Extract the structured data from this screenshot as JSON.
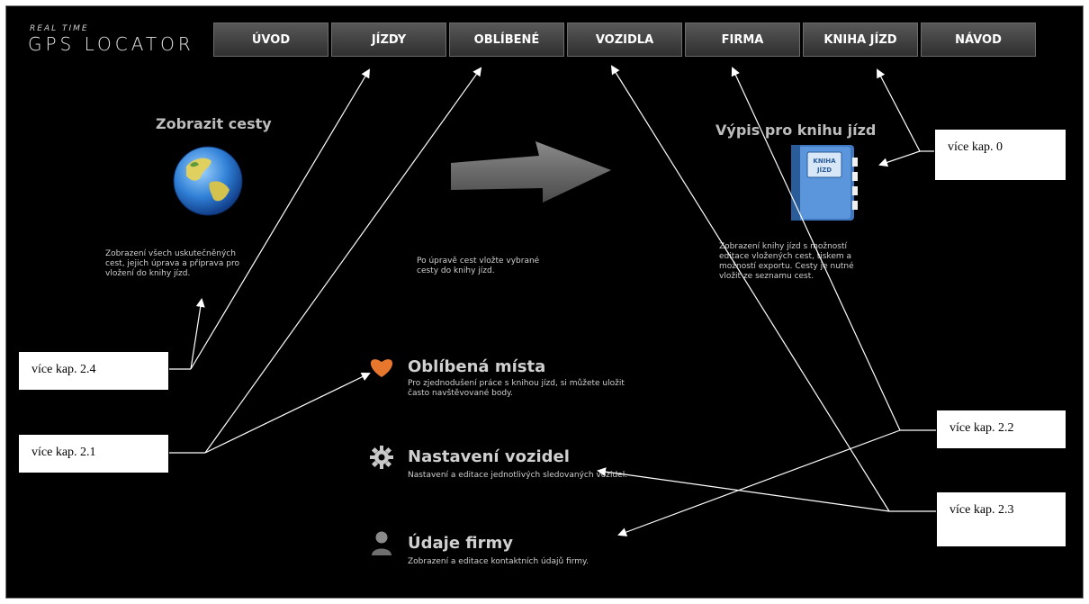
{
  "logo": {
    "top": "REAL TIME",
    "main": "GPS LOCATOR"
  },
  "nav": [
    "ÚVOD",
    "JÍZDY",
    "OBLÍBENÉ",
    "VOZIDLA",
    "FIRMA",
    "KNIHA JÍZD",
    "NÁVOD"
  ],
  "features": {
    "show_routes": {
      "title": "Zobrazit cesty",
      "desc1": "Zobrazení všech uskutečněných",
      "desc2": "cest, jejich úprava a příprava pro",
      "desc3": "vložení do knihy jízd."
    },
    "arrow_hint": {
      "desc1": "Po úpravě cest vložte vybrané",
      "desc2": "cesty do knihy jízd."
    },
    "logbook_export": {
      "title": "Výpis pro knihu jízd",
      "book_line1": "KNIHA",
      "book_line2": "JÍZD",
      "desc1": "Zobrazení knihy jízd s možností",
      "desc2": "editace vložených cest, tiskem a",
      "desc3": "možností exportu. Cesty je nutné",
      "desc4": "vložit ze seznamu cest."
    }
  },
  "items": {
    "favorites": {
      "title": "Oblíbená místa",
      "sub1": "Pro zjednodušení práce s knihou jízd, si můžete uložit",
      "sub2": "často navštěvované body."
    },
    "vehicles": {
      "title": "Nastavení vozidel",
      "sub1": "Nastavení a editace jednotlivých sledovaných vozidel."
    },
    "company": {
      "title": "Údaje firmy",
      "sub1": "Zobrazení a editace kontaktních údajů firmy."
    }
  },
  "callouts": {
    "c0": "více kap. 0",
    "c24": "více kap. 2.4",
    "c21": "více kap. 2.1",
    "c22": "více kap. 2.2",
    "c23": "více kap. 2.3"
  },
  "colors": {
    "background": "#000000",
    "tab_top": "#585858",
    "tab_bottom": "#2f2f2f",
    "heart": "#e8772e",
    "book": "#4a86c8"
  }
}
